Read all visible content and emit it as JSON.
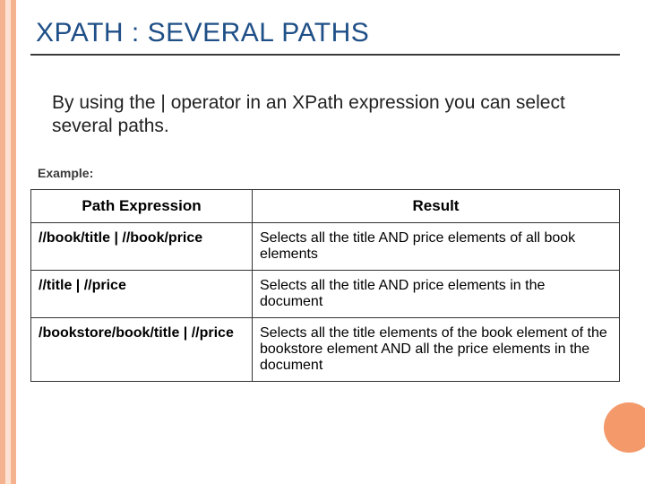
{
  "title": "XPATH : SEVERAL PATHS",
  "description": "By using the | operator in an XPath expression you can select several paths.",
  "example_label": "Example:",
  "table": {
    "headers": {
      "path": "Path Expression",
      "result": "Result"
    },
    "rows": [
      {
        "expr": "//book/title | //book/price",
        "result": "Selects all the title AND price elements of all book elements"
      },
      {
        "expr": "//title | //price",
        "result": "Selects all the title AND price elements in the document"
      },
      {
        "expr": "/bookstore/book/title | //price",
        "result": "Selects all the title elements of the book element of the bookstore element AND all the price elements in the document"
      }
    ]
  }
}
